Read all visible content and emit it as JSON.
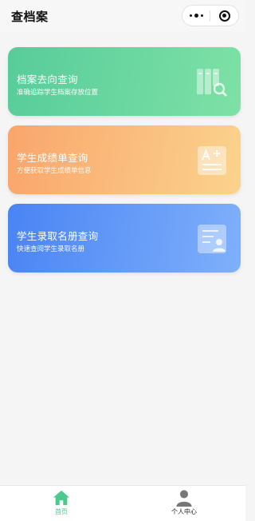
{
  "nav": {
    "title": "查档案"
  },
  "cards": [
    {
      "title": "档案去向查询",
      "subtitle": "准确追踪学生档案存放位置",
      "icon": "archive-search-icon"
    },
    {
      "title": "学生成绩单查询",
      "subtitle": "方便获取学生成绩单信息",
      "icon": "grade-sheet-icon"
    },
    {
      "title": "学生录取名册查询",
      "subtitle": "快速查阅学生录取名册",
      "icon": "admission-roster-icon"
    }
  ],
  "tabbar": {
    "items": [
      {
        "label": "首页",
        "icon": "home-icon",
        "active": true
      },
      {
        "label": "个人中心",
        "icon": "person-icon",
        "active": false
      }
    ]
  },
  "colors": {
    "accent": "#4cc98c",
    "card1": [
      "#57cc9a",
      "#7ee1a6"
    ],
    "card2": [
      "#f9a56c",
      "#fbd38c"
    ],
    "card3": [
      "#4a84f4",
      "#7fb0fb"
    ]
  }
}
